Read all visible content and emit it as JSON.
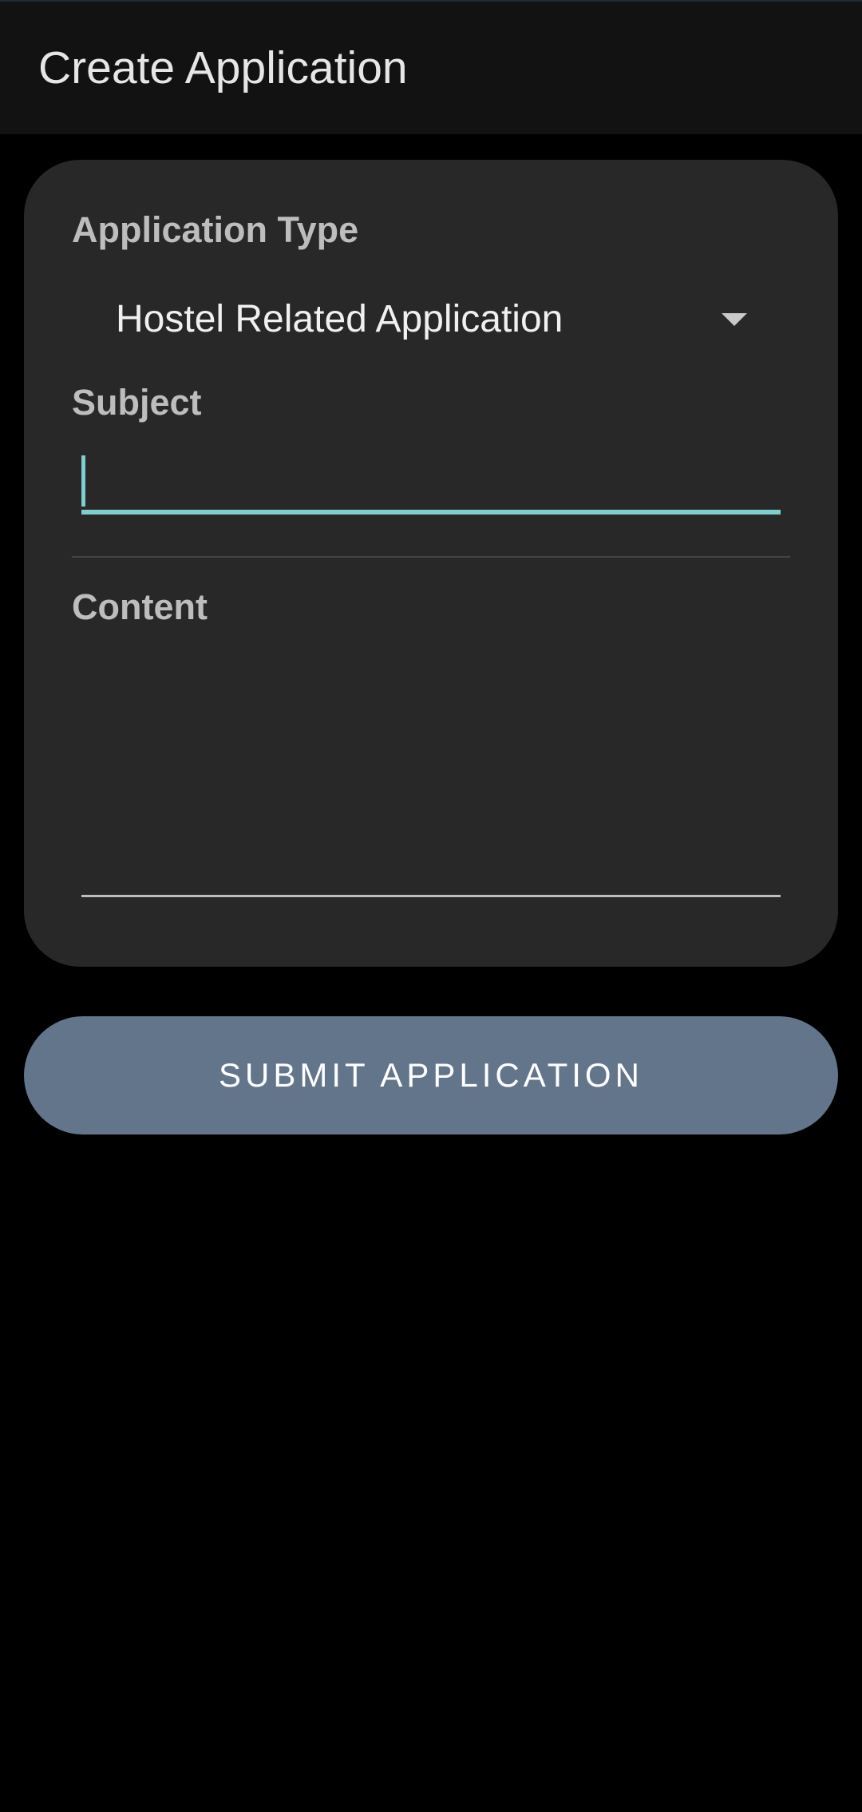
{
  "app_bar": {
    "title": "Create Application"
  },
  "form": {
    "application_type": {
      "label": "Application Type",
      "selected_value": "Hostel Related Application",
      "icon": "dropdown-arrow-icon"
    },
    "subject": {
      "label": "Subject",
      "value": "",
      "placeholder": ""
    },
    "content": {
      "label": "Content",
      "value": "",
      "placeholder": ""
    }
  },
  "submit_button": {
    "label": "SUBMIT APPLICATION"
  },
  "colors": {
    "background": "#000000",
    "app_bar": "#121212",
    "card": "#282828",
    "accent": "#7fcfcf",
    "button": "#62758a"
  }
}
